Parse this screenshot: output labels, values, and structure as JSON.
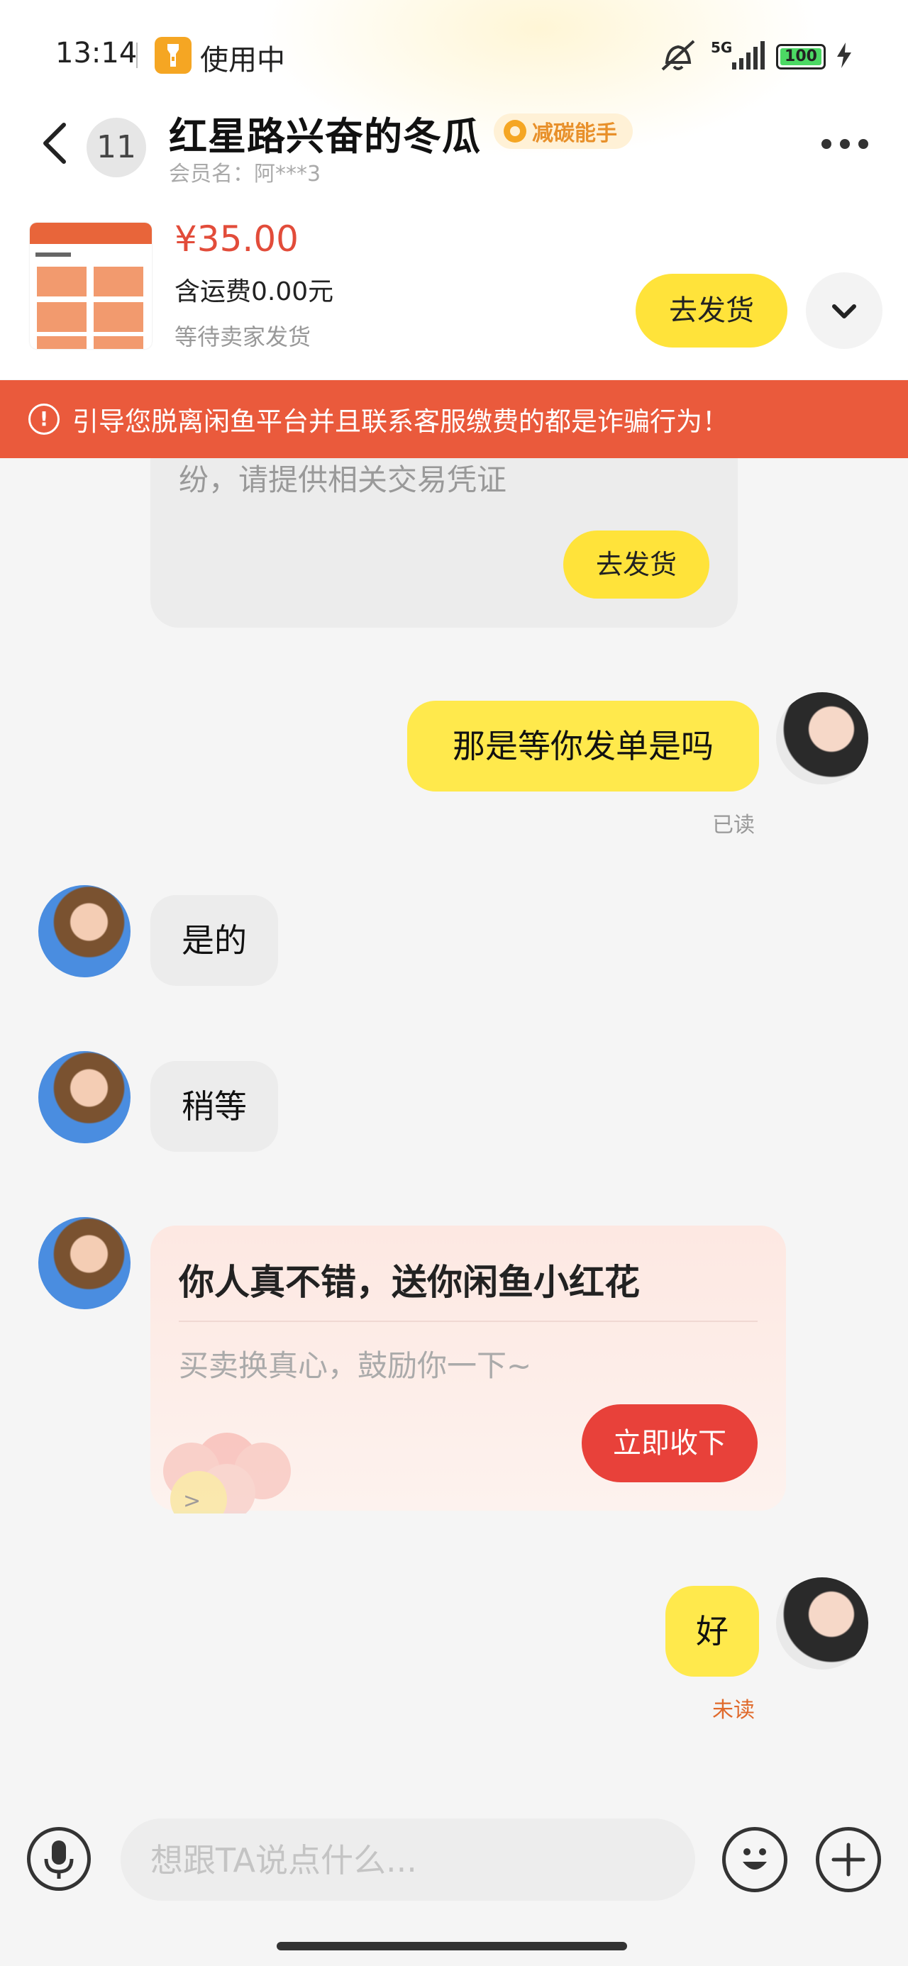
{
  "status_bar": {
    "time": "13:14",
    "app_label": "使用中",
    "network": "5G",
    "battery": "100",
    "battery_level": 1.0,
    "icons": [
      "flashlight-icon",
      "silent-icon",
      "signal-icon",
      "battery-icon",
      "charging-icon"
    ]
  },
  "header": {
    "unread_count": "11",
    "title": "红星路兴奋的冬瓜",
    "badge": "减碳能手",
    "member": "会员名：阿***3"
  },
  "product": {
    "price": "¥35.00",
    "shipping": "含运费0.00元",
    "status": "等待卖家发货",
    "ship_button": "去发货"
  },
  "warning": {
    "text": "引导您脱离闲鱼平台并且联系客服缴费的都是诈骗行为！"
  },
  "messages": {
    "system_text": "纷，请提供相关交易凭证",
    "system_button": "去发货",
    "m1": {
      "text": "那是等你发单是吗",
      "status": "已读"
    },
    "m2": {
      "text": "是的"
    },
    "m3": {
      "text": "稍等"
    },
    "gift": {
      "title": "你人真不错，送你闲鱼小红花",
      "subtitle": "买卖换真心，鼓励你一下~",
      "button": "立即收下"
    },
    "m4": {
      "text": "好",
      "status": "未读"
    }
  },
  "input": {
    "placeholder": "想跟TA说点什么..."
  },
  "colors": {
    "accent_yellow": "#ffe33a",
    "warning_red": "#ea5a3c",
    "price_red": "#e24c3a",
    "gift_button": "#e8413a",
    "unread_status": "#e06a2c"
  }
}
